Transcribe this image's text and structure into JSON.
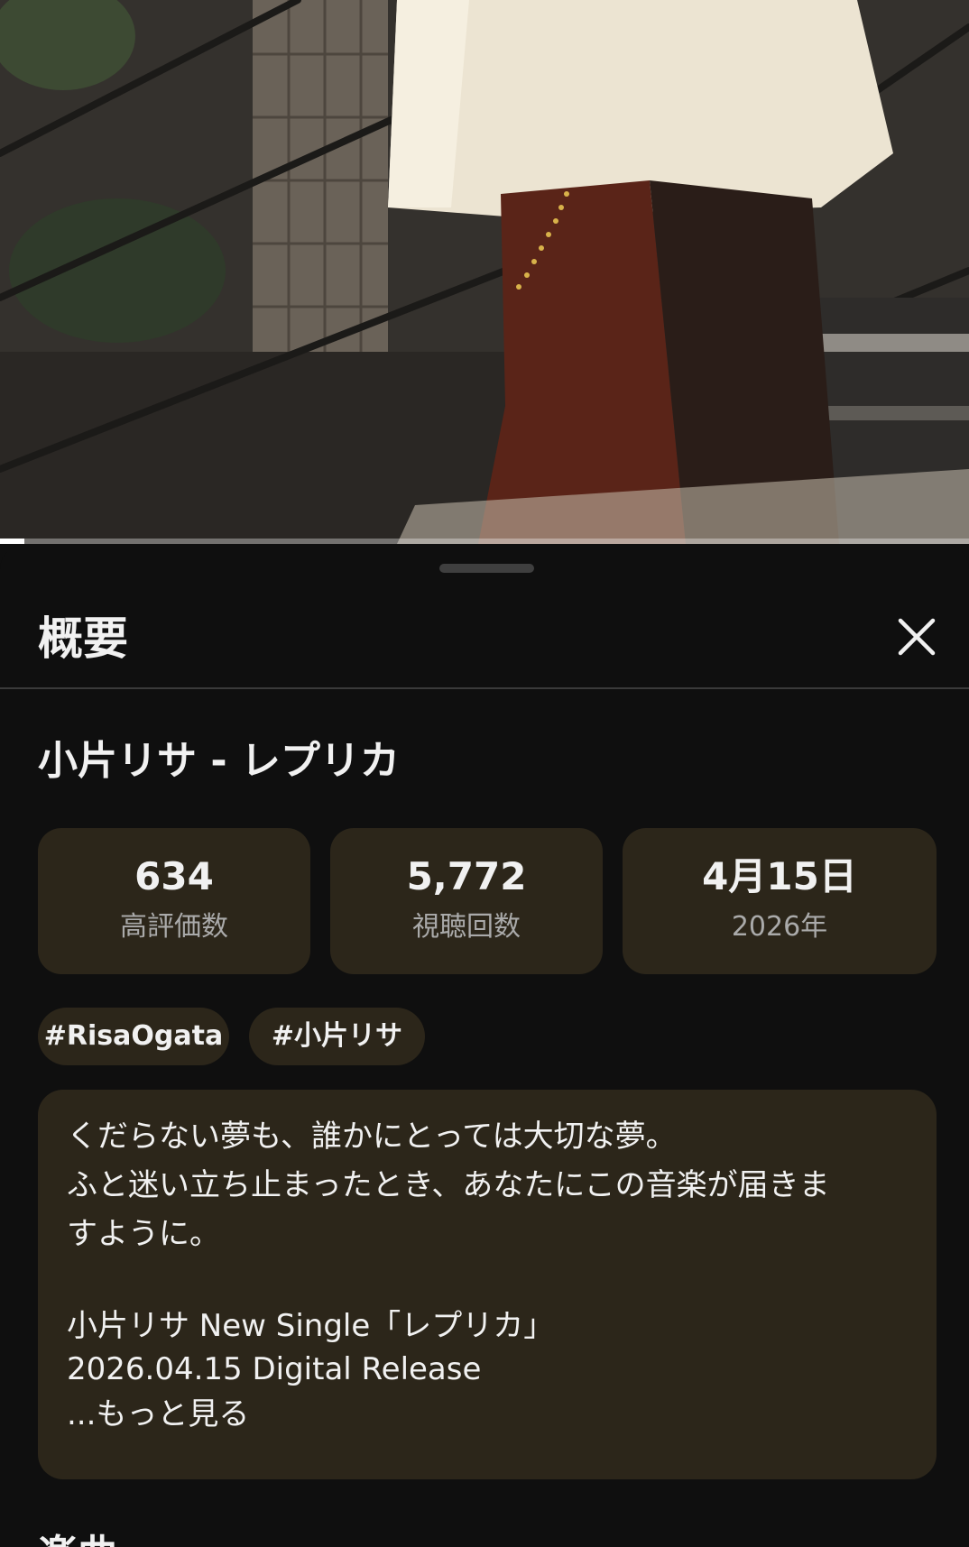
{
  "video": {
    "progress_fraction": 0.025
  },
  "sheet": {
    "title": "概要",
    "close_icon": "close-icon",
    "video_title": "小片リサ - レプリカ",
    "stats": [
      {
        "value": "634",
        "label": "高評価数"
      },
      {
        "value": "5,772",
        "label": "視聴回数"
      },
      {
        "value": "4月15日",
        "label": "2026年"
      }
    ],
    "tags": [
      "#RisaOgata",
      "#小片リサ"
    ],
    "description": {
      "lines": [
        "くだらない夢も、誰かにとっては大切な夢。",
        "ふと迷い立ち止まったとき、あなたにこの音楽が届きま",
        "すように。",
        "",
        "小片リサ New Single「レプリカ」",
        "2026.04.15 Digital Release"
      ],
      "more_label": "...もっと見る"
    },
    "next_section_title": "楽曲"
  }
}
